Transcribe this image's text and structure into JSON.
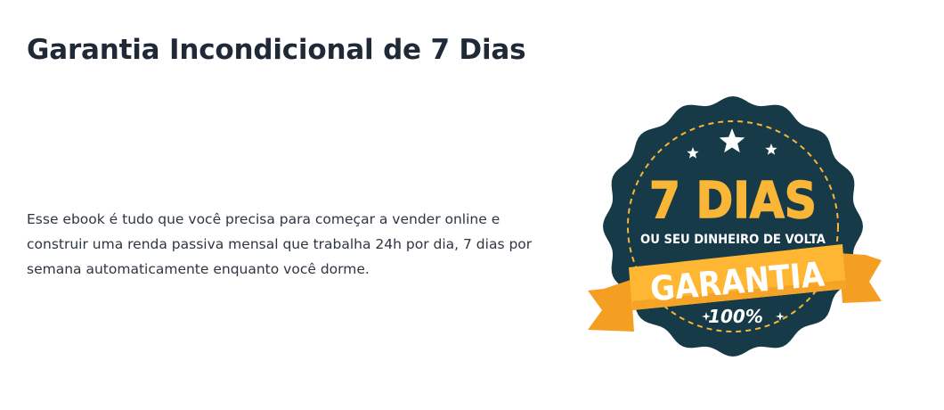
{
  "section": {
    "title": "Garantia Incondicional de 7 Dias",
    "description": "Esse ebook é tudo que você precisa para começar a vender online e construir uma renda passiva mensal que trabalha 24h por dia, 7 dias por semana automaticamente enquanto você dorme."
  },
  "badge": {
    "headline": "7 DIAS",
    "subline": "OU SEU DINHEIRO DE VOLTA",
    "ribbon": "GARANTIA",
    "percent": "100%",
    "colors": {
      "seal": "#163a48",
      "gold": "#f9b637",
      "ribbon": "#ffb733",
      "ribbon_dark": "#e08a1e",
      "white": "#ffffff"
    },
    "icons": [
      "star-icon",
      "star-icon",
      "star-icon",
      "sparkle-icon",
      "sparkle-icon"
    ]
  }
}
